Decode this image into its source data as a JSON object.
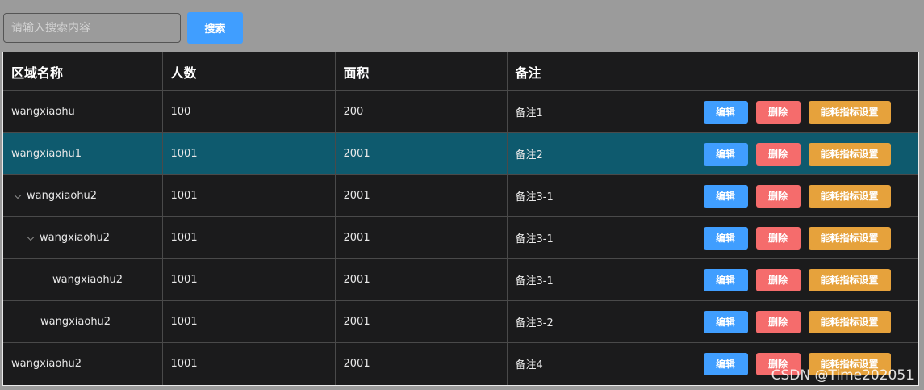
{
  "search": {
    "placeholder": "请输入搜索内容",
    "button_label": "搜索"
  },
  "table": {
    "headers": [
      "区域名称",
      "人数",
      "面积",
      "备注",
      ""
    ],
    "actions": {
      "edit": "编辑",
      "delete": "删除",
      "energy": "能耗指标设置"
    },
    "rows": [
      {
        "name": "wangxiaohu",
        "people": "100",
        "area": "200",
        "note": "备注1",
        "level": 0,
        "expand_icon": false,
        "selected": false
      },
      {
        "name": "wangxiaohu1",
        "people": "1001",
        "area": "2001",
        "note": "备注2",
        "level": 0,
        "expand_icon": false,
        "selected": true
      },
      {
        "name": "wangxiaohu2",
        "people": "1001",
        "area": "2001",
        "note": "备注3-1",
        "level": 0,
        "expand_icon": true,
        "selected": false
      },
      {
        "name": "wangxiaohu2",
        "people": "1001",
        "area": "2001",
        "note": "备注3-1",
        "level": 1,
        "expand_icon": true,
        "selected": false
      },
      {
        "name": "wangxiaohu2",
        "people": "1001",
        "area": "2001",
        "note": "备注3-1",
        "level": 2,
        "expand_icon": false,
        "selected": false
      },
      {
        "name": "wangxiaohu2",
        "people": "1001",
        "area": "2001",
        "note": "备注3-2",
        "level": 1,
        "expand_icon": false,
        "selected": false
      },
      {
        "name": "wangxiaohu2",
        "people": "1001",
        "area": "2001",
        "note": "备注4",
        "level": 0,
        "expand_icon": false,
        "selected": false
      }
    ]
  },
  "watermark": "CSDN @Time202051",
  "colors": {
    "background": "#9b9b9b",
    "table_bg": "#1b1b1c",
    "selected_row": "#0e5a6e",
    "primary": "#409eff",
    "danger": "#f56c6c",
    "warning": "#e6a23c"
  }
}
